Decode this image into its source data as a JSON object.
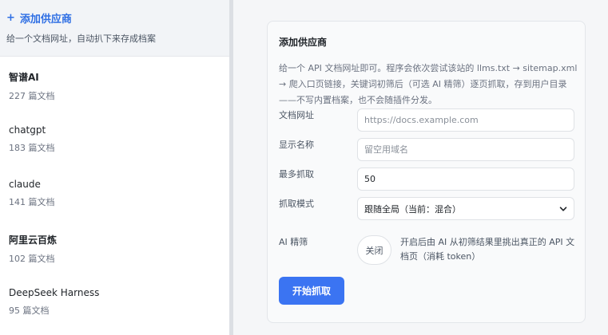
{
  "sidebar": {
    "add": {
      "icon": "plus-icon",
      "symbol": "+",
      "title": "添加供应商",
      "desc": "给一个文档网址，自动扒下来存成档案"
    },
    "providers": [
      {
        "name": "智谱AI",
        "count": "227 篇文档"
      },
      {
        "name": "chatgpt",
        "count": "183 篇文档"
      },
      {
        "name": "claude",
        "count": "141 篇文档"
      },
      {
        "name": "阿里云百炼",
        "count": "102 篇文档"
      },
      {
        "name": "DeepSeek Harness",
        "count": "95 篇文档"
      }
    ]
  },
  "form": {
    "title": "添加供应商",
    "desc": "给一个 API 文档网址即可。程序会依次尝试该站的 llms.txt → sitemap.xml → 爬入口页链接，关键词初筛后（可选 AI 精筛）逐页抓取，存到用户目录——不写内置档案，也不会随插件分发。",
    "url_label": "文档网址",
    "url_placeholder": "https://docs.example.com",
    "name_label": "显示名称",
    "name_placeholder": "留空用域名",
    "max_label": "最多抓取",
    "max_value": "50",
    "mode_label": "抓取模式",
    "mode_value": "跟随全局（当前：混合）",
    "ai_label": "AI 精筛",
    "ai_toggle": "关闭",
    "ai_desc": "开启后由 AI 从初筛结果里挑出真正的 API 文档页（消耗 token）",
    "start_button": "开始抓取"
  },
  "colors": {
    "accent": "#3b74f2",
    "link": "#2f6fe4"
  }
}
